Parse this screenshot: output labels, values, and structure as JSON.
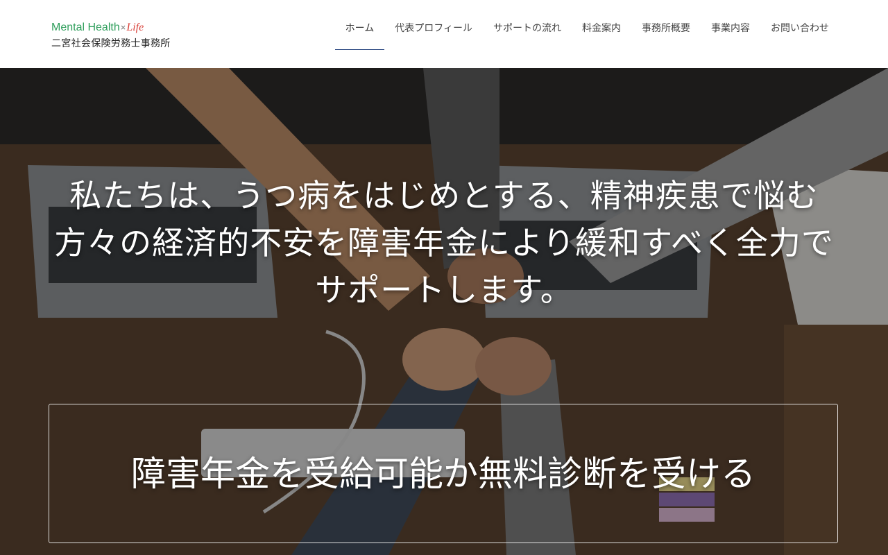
{
  "logo": {
    "brand_green": "Mental Health",
    "cross": "×",
    "brand_red": "Life",
    "subtitle": "二宮社会保険労務士事務所"
  },
  "nav": {
    "items": [
      {
        "label": "ホーム",
        "active": true
      },
      {
        "label": "代表プロフィール"
      },
      {
        "label": "サポートの流れ"
      },
      {
        "label": "料金案内"
      },
      {
        "label": "事務所概要"
      },
      {
        "label": "事業内容"
      },
      {
        "label": "お問い合わせ"
      }
    ]
  },
  "hero": {
    "headline": "私たちは、うつ病をはじめとする、精神疾患で悩む方々の経済的不安を障害年金により緩和すべく全力でサポートします。",
    "cta": "障害年金を受給可能か無料診断を受ける"
  },
  "colors": {
    "brand_green": "#2e9e5b",
    "brand_red": "#d9423b",
    "nav_active_underline": "#1f3d7a"
  }
}
